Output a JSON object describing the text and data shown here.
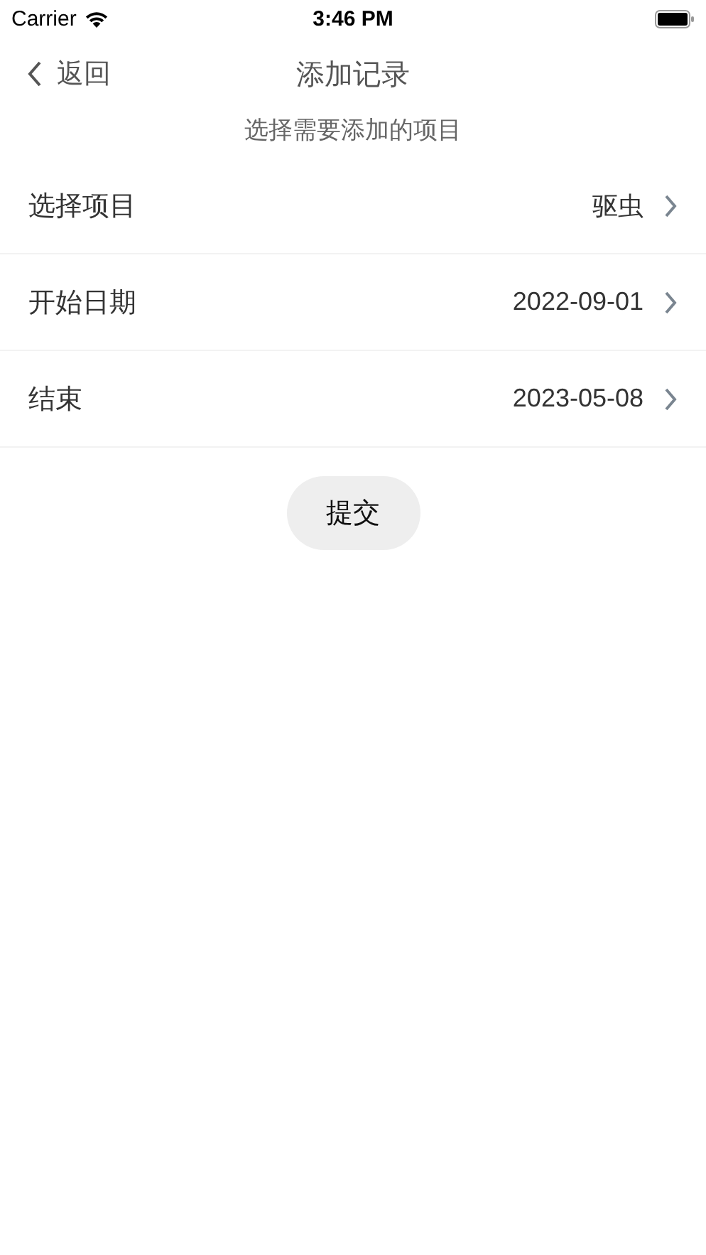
{
  "status_bar": {
    "carrier": "Carrier",
    "time": "3:46 PM"
  },
  "nav": {
    "back": "返回",
    "title": "添加记录"
  },
  "subtitle": "选择需要添加的项目",
  "rows": [
    {
      "label": "选择项目",
      "value": "驱虫"
    },
    {
      "label": "开始日期",
      "value": "2022-09-01"
    },
    {
      "label": "结束",
      "value": "2023-05-08"
    }
  ],
  "submit": "提交"
}
